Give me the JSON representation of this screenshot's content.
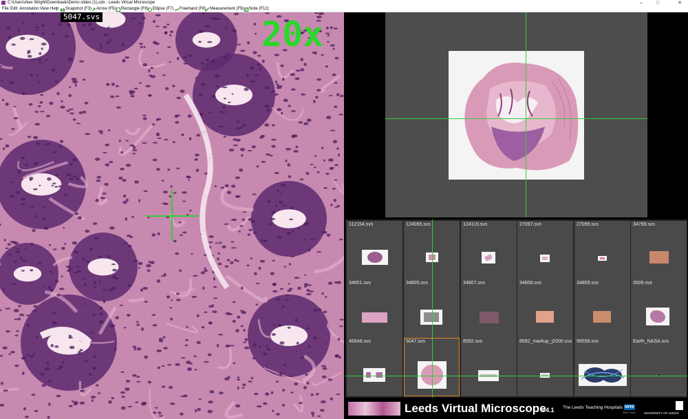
{
  "window": {
    "title": "C:\\Users\\Alex Wright\\Downloads\\Demo slides (1).cdx - Leeds Virtual Microscope",
    "minimize": "–",
    "maximize": "□",
    "close": "✕"
  },
  "menu": {
    "items": [
      "File",
      "Edit",
      "Annotation",
      "View",
      "Help"
    ],
    "tools": [
      {
        "label": "Snapshot (F3)",
        "icon": "camera-icon",
        "color": "#2a8a2a"
      },
      {
        "label": "Arrow (F5)",
        "icon": "arrow-icon",
        "color": "#2a8a2a"
      },
      {
        "label": "Rectangle (F6)",
        "icon": "rectangle-icon",
        "color": "#2a8a2a"
      },
      {
        "label": "Ellipse (F7)",
        "icon": "ellipse-icon",
        "color": "#2a8a2a"
      },
      {
        "label": "Freehand (F8)",
        "icon": "freehand-icon",
        "color": "#2a8a2a"
      },
      {
        "label": "Measurement (F9)",
        "icon": "ruler-icon",
        "color": "#2a8a2a"
      },
      {
        "label": "Note (F12)",
        "icon": "note-icon",
        "color": "#2a8a2a"
      }
    ]
  },
  "viewer": {
    "slide_name": "5047.svs",
    "zoom": "20x",
    "accent": "#2bd62b"
  },
  "thumbnails": [
    {
      "name": "112154.svs"
    },
    {
      "name": "124065.svs"
    },
    {
      "name": "124119.svs"
    },
    {
      "name": "27097.svs"
    },
    {
      "name": "27099.svs"
    },
    {
      "name": "34799.svs"
    },
    {
      "name": "34801.svs"
    },
    {
      "name": "34805.svs"
    },
    {
      "name": "34807.svs"
    },
    {
      "name": "34808.svs"
    },
    {
      "name": "34809.svs"
    },
    {
      "name": "3509.svs"
    },
    {
      "name": "46648.svs"
    },
    {
      "name": "5047.svs",
      "selected": true
    },
    {
      "name": "8592.svs"
    },
    {
      "name": "8592_markup_j2000.svs"
    },
    {
      "name": "99558.svs"
    },
    {
      "name": "Earth_NASA.svs"
    }
  ],
  "footer": {
    "app_name": "Leeds Virtual Microscope",
    "version": "v4.1",
    "trust": "The Leeds Teaching Hospitals",
    "nhs": "NHS",
    "nhs_sub": "NHS Trust",
    "university": "UNIVERSITY OF LEEDS"
  }
}
